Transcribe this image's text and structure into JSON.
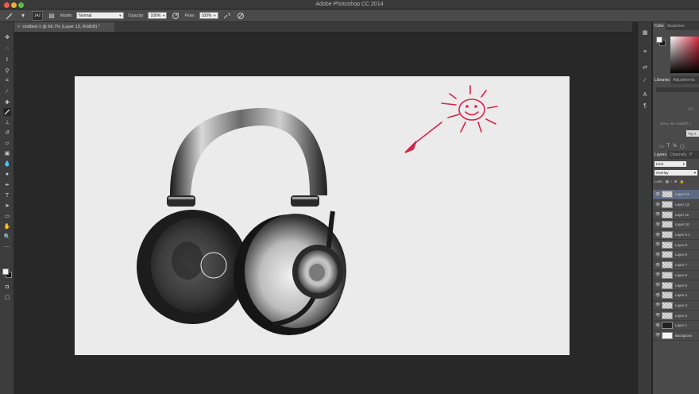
{
  "window": {
    "title": "Adobe Photoshop CC 2014"
  },
  "options_bar": {
    "brush_size": "142",
    "mode_label": "Mode:",
    "mode_value": "Normal",
    "opacity_label": "Opacity:",
    "opacity_value": "100%",
    "flow_label": "Flow:",
    "flow_value": "100%"
  },
  "document_tab": {
    "label": "Untitled-1 @ 66.7% (Layer 13, RGB/8) *",
    "close_glyph": "×"
  },
  "panels": {
    "color_tabs": [
      "Color",
      "Swatches"
    ],
    "library_tabs": [
      "Libraries",
      "Adjustments"
    ],
    "library_message": "Sorry, we couldn't c",
    "library_button": "Try A",
    "layers_tabs": [
      "Layers",
      "Channels",
      "P"
    ],
    "kind_filter": "Kind",
    "blend_mode": "Overlay",
    "lock_label": "Lock:",
    "layers": [
      {
        "name": "Layer 13",
        "selected": true,
        "thumb": "transparent"
      },
      {
        "name": "Layer 12",
        "selected": false,
        "thumb": "transparent"
      },
      {
        "name": "Layer 11",
        "selected": false,
        "thumb": "transparent"
      },
      {
        "name": "Layer 10",
        "selected": false,
        "thumb": "transparent"
      },
      {
        "name": "Layer 9 c",
        "selected": false,
        "thumb": "transparent"
      },
      {
        "name": "Layer 9",
        "selected": false,
        "thumb": "transparent"
      },
      {
        "name": "Layer 8",
        "selected": false,
        "thumb": "transparent"
      },
      {
        "name": "Layer 7",
        "selected": false,
        "thumb": "transparent"
      },
      {
        "name": "Layer 6",
        "selected": false,
        "thumb": "transparent"
      },
      {
        "name": "Layer 5",
        "selected": false,
        "thumb": "transparent"
      },
      {
        "name": "Layer 4",
        "selected": false,
        "thumb": "transparent"
      },
      {
        "name": "Layer 3",
        "selected": false,
        "thumb": "transparent"
      },
      {
        "name": "Layer 2",
        "selected": false,
        "thumb": "transparent"
      },
      {
        "name": "Layer 1",
        "selected": false,
        "thumb": "dark"
      },
      {
        "name": "Backgroun",
        "selected": false,
        "thumb": "white"
      }
    ]
  },
  "colors": {
    "accent_selection": "#5d6a80",
    "sketch_red": "#d8234a",
    "foreground": "#f4f4f4",
    "background": "#111111"
  },
  "icons": {
    "tools": [
      "move-icon",
      "marquee-icon",
      "lasso-icon",
      "quick-select-icon",
      "crop-icon",
      "eyedropper-icon",
      "healing-icon",
      "brush-icon",
      "stamp-icon",
      "history-brush-icon",
      "eraser-icon",
      "gradient-icon",
      "blur-icon",
      "dodge-icon",
      "pen-icon",
      "type-icon",
      "path-select-icon",
      "shape-icon",
      "hand-icon",
      "zoom-icon",
      "quick-mask-icon",
      "screen-mode-icon"
    ]
  }
}
